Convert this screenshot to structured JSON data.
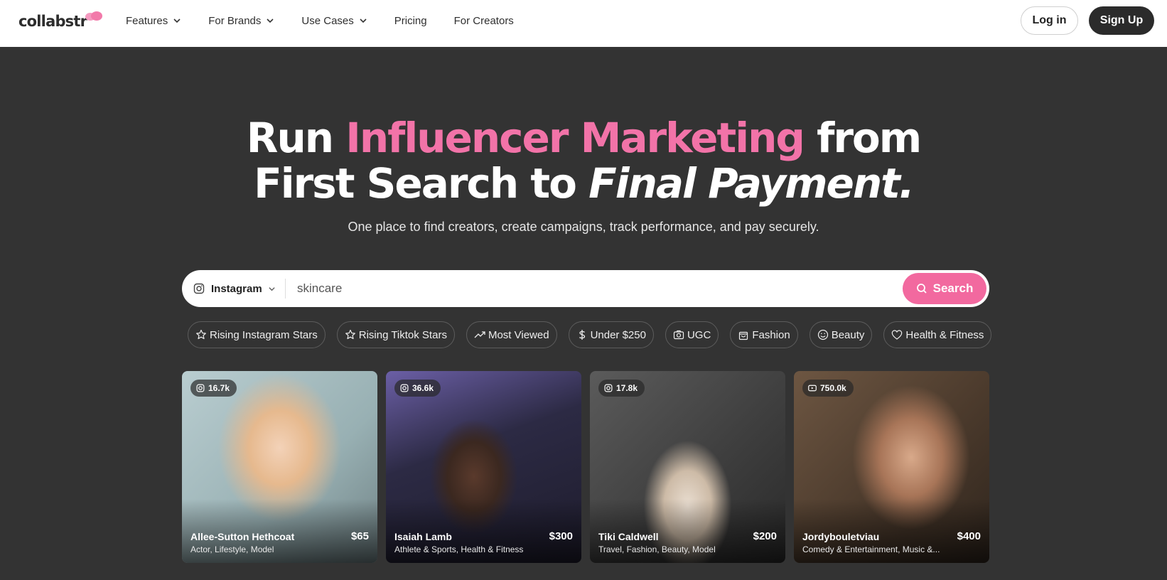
{
  "nav": {
    "logo": "collabstr",
    "links": [
      {
        "label": "Features",
        "dropdown": true
      },
      {
        "label": "For Brands",
        "dropdown": true
      },
      {
        "label": "Use Cases",
        "dropdown": true
      },
      {
        "label": "Pricing",
        "dropdown": false
      },
      {
        "label": "For Creators",
        "dropdown": false
      }
    ],
    "login": "Log in",
    "signup": "Sign Up"
  },
  "hero": {
    "run": "Run",
    "highlight": "Influencer Marketing",
    "from": "from",
    "line2_plain": "First Search to",
    "line2_italic": "Final Payment.",
    "subtitle": "One place to find creators, create campaigns, track performance, and pay securely."
  },
  "search": {
    "platform": "Instagram",
    "query": "skincare",
    "button": "Search"
  },
  "chips": [
    {
      "label": "Rising Instagram Stars",
      "icon": "star-icon"
    },
    {
      "label": "Rising Tiktok Stars",
      "icon": "star-icon"
    },
    {
      "label": "Most Viewed",
      "icon": "trending-icon"
    },
    {
      "label": "Under $250",
      "icon": "dollar-icon"
    },
    {
      "label": "UGC",
      "icon": "camera-icon"
    },
    {
      "label": "Fashion",
      "icon": "bag-icon"
    },
    {
      "label": "Beauty",
      "icon": "smile-icon"
    },
    {
      "label": "Health & Fitness",
      "icon": "heart-icon"
    }
  ],
  "creators": [
    {
      "followers": "16.7k",
      "platform_icon": "instagram-icon",
      "name": "Allee-Sutton Hethcoat",
      "price": "$65",
      "categories": "Actor, Lifestyle, Model"
    },
    {
      "followers": "36.6k",
      "platform_icon": "instagram-icon",
      "name": "Isaiah Lamb",
      "price": "$300",
      "categories": "Athlete & Sports, Health & Fitness"
    },
    {
      "followers": "17.8k",
      "platform_icon": "instagram-icon",
      "name": "Tiki Caldwell",
      "price": "$200",
      "categories": "Travel, Fashion, Beauty, Model"
    },
    {
      "followers": "750.0k",
      "platform_icon": "youtube-icon",
      "name": "Jordybouletviau",
      "price": "$400",
      "categories": "Comedy & Entertainment, Music &..."
    }
  ],
  "colors": {
    "brand_pink": "#f273a8",
    "hero_bg": "#333333",
    "signup_bg": "#2b2b2b"
  }
}
